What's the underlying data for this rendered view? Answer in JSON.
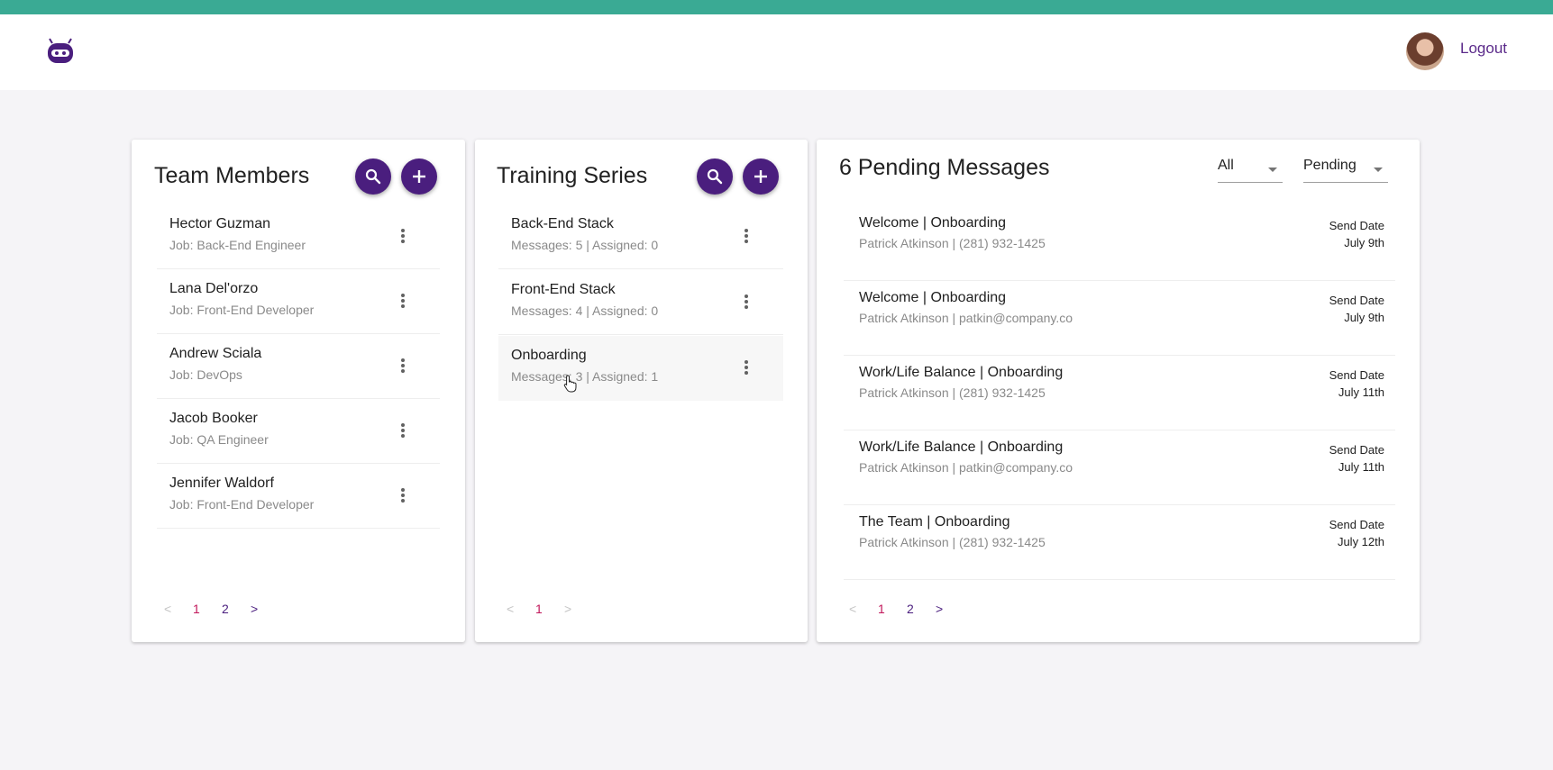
{
  "header": {
    "logout_label": "Logout",
    "logo_icon": "robot-logo-icon",
    "avatar": "user-avatar"
  },
  "colors": {
    "accent": "#4a1e7e",
    "stripe": "#3aaa94",
    "active_page": "#c2185b"
  },
  "team": {
    "title": "Team Members",
    "members": [
      {
        "name": "Hector Guzman",
        "job": "Job: Back-End Engineer"
      },
      {
        "name": "Lana Del'orzo",
        "job": "Job: Front-End Developer"
      },
      {
        "name": "Andrew Sciala",
        "job": "Job: DevOps"
      },
      {
        "name": "Jacob Booker",
        "job": "Job: QA Engineer"
      },
      {
        "name": "Jennifer Waldorf",
        "job": "Job: Front-End Developer"
      }
    ],
    "pager": {
      "prev": "<",
      "pages": [
        "1",
        "2"
      ],
      "next": ">",
      "current": "1"
    }
  },
  "training": {
    "title": "Training Series",
    "series": [
      {
        "name": "Back-End Stack",
        "meta": "Messages: 5 | Assigned: 0"
      },
      {
        "name": "Front-End Stack",
        "meta": "Messages: 4 | Assigned: 0"
      },
      {
        "name": "Onboarding",
        "meta": "Messages: 3 | Assigned: 1"
      }
    ],
    "pager": {
      "prev": "<",
      "pages": [
        "1"
      ],
      "next": ">",
      "current": "1"
    }
  },
  "messages": {
    "title": "6 Pending Messages",
    "filter_all": "All",
    "filter_status": "Pending",
    "items": [
      {
        "title": "Welcome | Onboarding",
        "sub": "Patrick Atkinson | (281) 932-1425",
        "date_label": "Send Date",
        "date": "July 9th"
      },
      {
        "title": "Welcome | Onboarding",
        "sub": "Patrick Atkinson | patkin@company.co",
        "date_label": "Send Date",
        "date": "July 9th"
      },
      {
        "title": "Work/Life Balance | Onboarding",
        "sub": "Patrick Atkinson | (281) 932-1425",
        "date_label": "Send Date",
        "date": "July 11th"
      },
      {
        "title": "Work/Life Balance | Onboarding",
        "sub": "Patrick Atkinson | patkin@company.co",
        "date_label": "Send Date",
        "date": "July 11th"
      },
      {
        "title": "The Team | Onboarding",
        "sub": "Patrick Atkinson | (281) 932-1425",
        "date_label": "Send Date",
        "date": "July 12th"
      }
    ],
    "pager": {
      "prev": "<",
      "pages": [
        "1",
        "2"
      ],
      "next": ">",
      "current": "1"
    }
  }
}
